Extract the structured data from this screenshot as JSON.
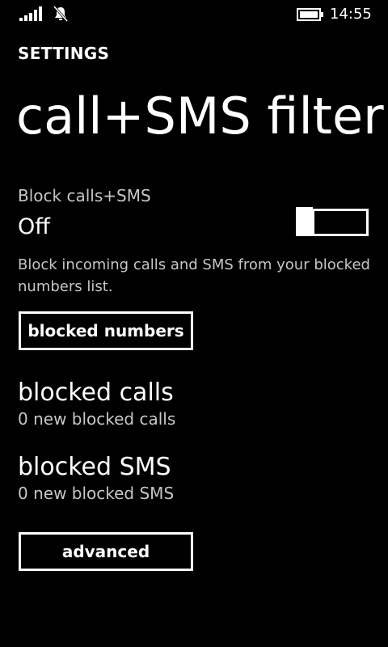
{
  "status_bar": {
    "time": "14:55",
    "icons": [
      "signal-icon",
      "bell-icon",
      "battery-icon"
    ]
  },
  "app": {
    "title": "SETTINGS",
    "page_title": "call+SMS filter"
  },
  "block_toggle": {
    "label": "Block calls+SMS",
    "state": "Off",
    "value": false,
    "description": "Block incoming calls and SMS from your blocked numbers list."
  },
  "buttons": {
    "blocked_numbers": "blocked numbers",
    "advanced": "advanced"
  },
  "nav_items": [
    {
      "title": "blocked calls",
      "subtitle": "0 new blocked calls"
    },
    {
      "title": "blocked SMS",
      "subtitle": "0 new blocked SMS"
    }
  ],
  "colors": {
    "background": "#000000",
    "foreground": "#ffffff",
    "secondary_text": "#c6c6c6"
  }
}
